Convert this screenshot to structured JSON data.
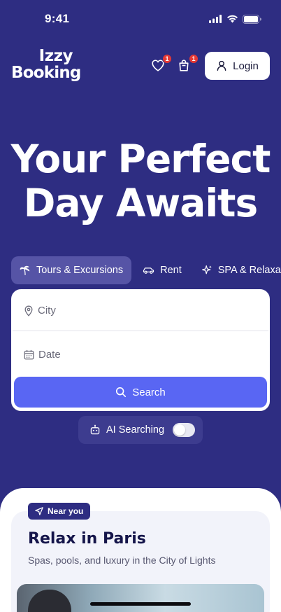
{
  "status": {
    "time": "9:41"
  },
  "brand": {
    "line1": "Izzy",
    "line2": "Booking"
  },
  "header": {
    "favorites_badge": "1",
    "cart_badge": "1",
    "login_label": "Login"
  },
  "hero": {
    "line1": "Your Perfect",
    "line2": "Day Awaits"
  },
  "tabs": [
    {
      "label": "Tours & Excursions",
      "icon": "palm-tree-icon",
      "active": true
    },
    {
      "label": "Rent",
      "icon": "car-icon",
      "active": false
    },
    {
      "label": "SPA & Relaxation",
      "icon": "sparkles-icon",
      "active": false
    }
  ],
  "search": {
    "city_placeholder": "City",
    "date_placeholder": "Date",
    "button_label": "Search"
  },
  "ai": {
    "label": "AI Searching",
    "enabled": false
  },
  "near": {
    "badge": "Near you",
    "title": "Relax in Paris",
    "subtitle": "Spas, pools, and luxury in the City of Lights"
  },
  "colors": {
    "background": "#2e2d82",
    "accent": "#5966f3",
    "badge": "#e53935"
  }
}
